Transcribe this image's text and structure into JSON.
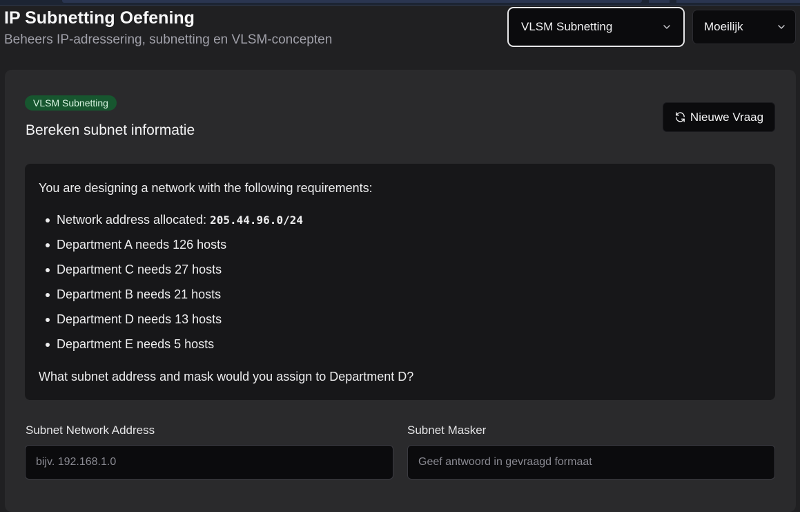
{
  "header": {
    "title": "IP Subnetting Oefening",
    "subtitle": "Beheers IP-adressering, subnetting en VLSM-concepten"
  },
  "controls": {
    "mode_select": {
      "value": "VLSM Subnetting",
      "icon": "chevron-down-icon"
    },
    "difficulty_select": {
      "value": "Moeilijk",
      "icon": "chevron-down-icon"
    }
  },
  "card": {
    "badge": "VLSM Subnetting",
    "title": "Bereken subnet informatie",
    "new_question_button": {
      "label": "Nieuwe Vraag",
      "icon": "refresh-icon"
    }
  },
  "question": {
    "intro": "You are designing a network with the following requirements:",
    "network_label": "Network address allocated: ",
    "network_value": "205.44.96.0/24",
    "requirements": [
      "Department A needs 126 hosts",
      "Department C needs 27 hosts",
      "Department B needs 21 hosts",
      "Department D needs 13 hosts",
      "Department E needs 5 hosts"
    ],
    "ask": "What subnet address and mask would you assign to Department D?"
  },
  "answer": {
    "network_address": {
      "label": "Subnet Network Address",
      "value": "",
      "placeholder": "bijv. 192.168.1.0"
    },
    "mask": {
      "label": "Subnet Masker",
      "value": "",
      "placeholder": "Geef antwoord in gevraagd formaat"
    }
  },
  "colors": {
    "background": "#202022",
    "card": "#2a2a2c",
    "badge_bg": "#17562f",
    "input_bg": "#0b0b0d"
  }
}
